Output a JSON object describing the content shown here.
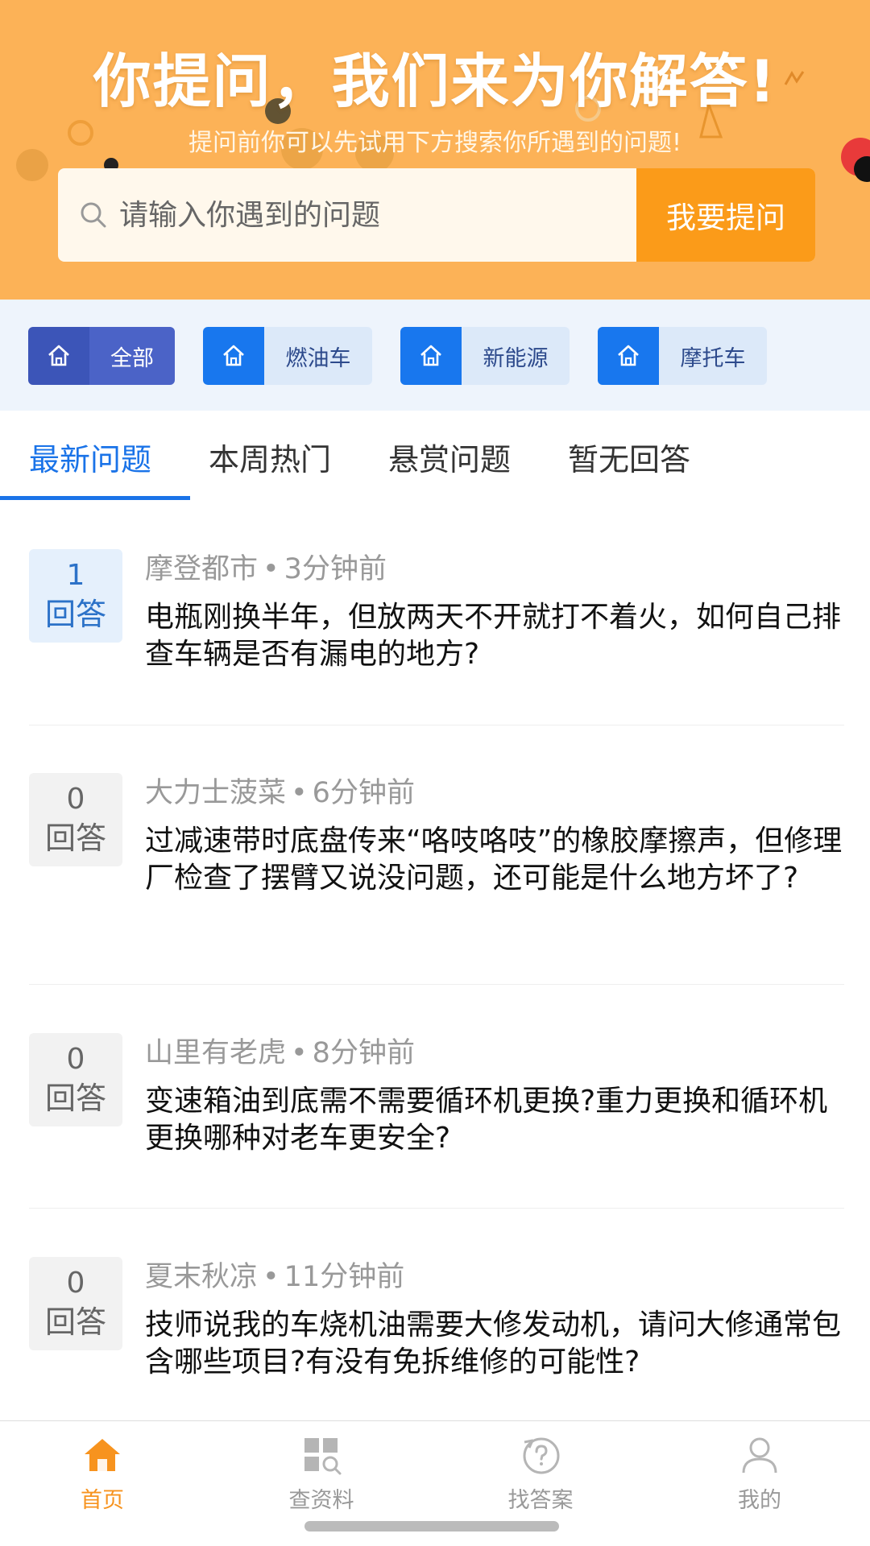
{
  "banner": {
    "title": "你提问，我们来为你解答!",
    "subtitle": "提问前你可以先试用下方搜索你所遇到的问题!",
    "search_placeholder": "请输入你遇到的问题",
    "ask_button": "我要提问",
    "colors": {
      "background": "#fcb257",
      "button": "#fb9b19"
    }
  },
  "categories": [
    {
      "label": "全部",
      "icon": "home-icon",
      "active": true
    },
    {
      "label": "燃油车",
      "icon": "home-icon",
      "active": false
    },
    {
      "label": "新能源",
      "icon": "home-icon",
      "active": false
    },
    {
      "label": "摩托车",
      "icon": "home-icon",
      "active": false
    }
  ],
  "tabs": [
    {
      "label": "最新问题",
      "active": true
    },
    {
      "label": "本周热门",
      "active": false
    },
    {
      "label": "悬赏问题",
      "active": false
    },
    {
      "label": "暂无回答",
      "active": false
    }
  ],
  "questions": [
    {
      "answer_count": "1",
      "answer_label": "回答",
      "user": "摩登都市",
      "time": "3分钟前",
      "title": "电瓶刚换半年，但放两天不开就打不着火，如何自己排查车辆是否有漏电的地方?"
    },
    {
      "answer_count": "0",
      "answer_label": "回答",
      "user": "大力士菠菜",
      "time": "6分钟前",
      "title": "过减速带时底盘传来“咯吱咯吱”的橡胶摩擦声，但修理厂检查了摆臂又说没问题，还可能是什么地方坏了?"
    },
    {
      "answer_count": "0",
      "answer_label": "回答",
      "user": "山里有老虎",
      "time": "8分钟前",
      "title": "变速箱油到底需不需要循环机更换?重力更换和循环机更换哪种对老车更安全?"
    },
    {
      "answer_count": "0",
      "answer_label": "回答",
      "user": "夏末秋凉",
      "time": "11分钟前",
      "title": "技师说我的车烧机油需要大修发动机，请问大修通常包含哪些项目?有没有免拆维修的可能性?"
    }
  ],
  "bottom_nav": [
    {
      "label": "首页",
      "icon": "home-icon",
      "active": true
    },
    {
      "label": "查资料",
      "icon": "grid-search-icon",
      "active": false
    },
    {
      "label": "找答案",
      "icon": "question-bubble-icon",
      "active": false
    },
    {
      "label": "我的",
      "icon": "user-icon",
      "active": false
    }
  ],
  "colors": {
    "accent_blue": "#1a73e8",
    "accent_orange": "#f7931e"
  }
}
